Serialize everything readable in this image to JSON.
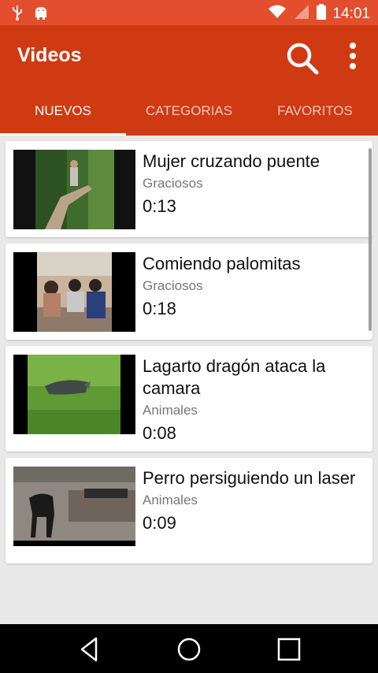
{
  "status_bar": {
    "time": "14:01",
    "icons": [
      "usb-icon",
      "android-debug-icon",
      "wifi-icon",
      "signal-icon",
      "battery-icon"
    ]
  },
  "app_bar": {
    "title": "Videos",
    "actions": [
      "search-icon",
      "more-vert-icon"
    ],
    "background": "#cf3a13"
  },
  "tabs": [
    {
      "label": "NUEVOS",
      "active": true
    },
    {
      "label": "CATEGORIAS",
      "active": false
    },
    {
      "label": "FAVORITOS",
      "active": false
    }
  ],
  "videos": [
    {
      "title": "Mujer cruzando puente",
      "category": "Graciosos",
      "duration": "0:13"
    },
    {
      "title": "Comiendo palomitas",
      "category": "Graciosos",
      "duration": "0:18"
    },
    {
      "title": "Lagarto dragón ataca la camara",
      "category": "Animales",
      "duration": "0:08"
    },
    {
      "title": "Perro persiguiendo un laser",
      "category": "Animales",
      "duration": "0:09"
    }
  ],
  "nav_bar": {
    "buttons": [
      "back-icon",
      "home-icon",
      "recents-icon"
    ]
  }
}
